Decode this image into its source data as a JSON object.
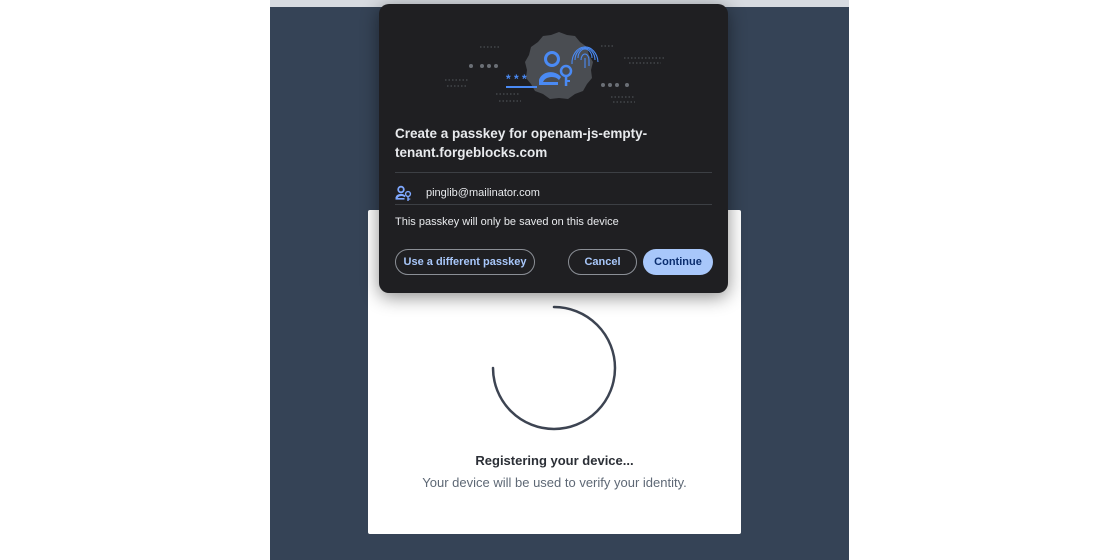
{
  "dialog": {
    "title": "Create a passkey for openam-js-empty-tenant.forgeblocks.com",
    "account_email": "pinglib@mailinator.com",
    "note": "This passkey will only be saved on this device",
    "buttons": {
      "different_passkey": "Use a different passkey",
      "cancel": "Cancel",
      "continue": "Continue"
    },
    "icons": {
      "hero": "passkey-illustration-icon",
      "account": "person-key-icon"
    },
    "colors": {
      "background": "#1f1f22",
      "accent": "#a8c7fa",
      "icon_blue": "#4a8af4"
    }
  },
  "card": {
    "title": "Registering your device...",
    "subtitle": "Your device will be used to verify your identity.",
    "spinner_icon": "loading-spinner-icon"
  },
  "colors": {
    "page_background": "#354356",
    "card_background": "#ffffff"
  }
}
